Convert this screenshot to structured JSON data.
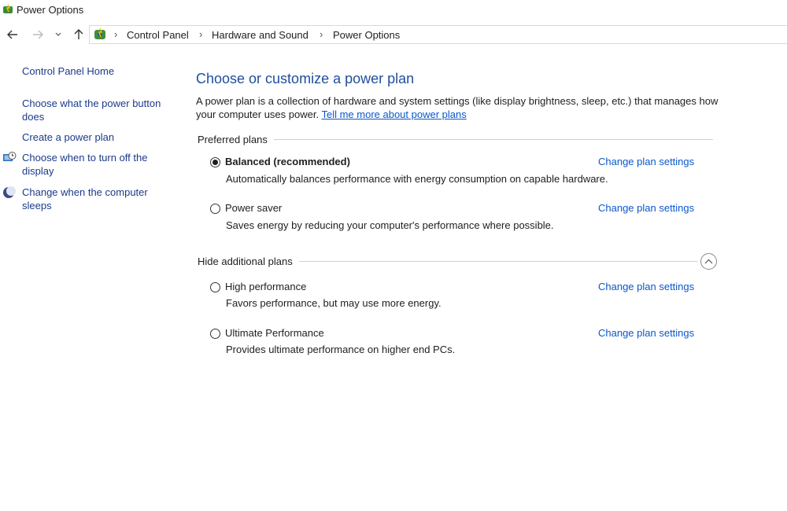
{
  "window": {
    "title": "Power Options"
  },
  "address_bar": {
    "breadcrumbs": [
      "Control Panel",
      "Hardware and Sound",
      "Power Options"
    ]
  },
  "sidebar": {
    "home": "Control Panel Home",
    "items": [
      {
        "label": "Choose what the power button does",
        "icon": null
      },
      {
        "label": "Create a power plan",
        "icon": null
      },
      {
        "label": "Choose when to turn off the display",
        "icon": "display-clock-icon"
      },
      {
        "label": "Change when the computer sleeps",
        "icon": "moon-icon"
      }
    ]
  },
  "main": {
    "title": "Choose or customize a power plan",
    "intro": "A power plan is a collection of hardware and system settings (like display brightness, sleep, etc.) that manages how your computer uses power.",
    "intro_link": "Tell me more about power plans",
    "preferred_label": "Preferred plans",
    "additional_label": "Hide additional plans",
    "change_link_label": "Change plan settings",
    "plans": [
      {
        "name": "Balanced (recommended)",
        "desc": "Automatically balances performance with energy consumption on capable hardware.",
        "selected": true
      },
      {
        "name": "Power saver",
        "desc": "Saves energy by reducing your computer's performance where possible.",
        "selected": false
      },
      {
        "name": "High performance",
        "desc": "Favors performance, but may use more energy.",
        "selected": false
      },
      {
        "name": "Ultimate Performance",
        "desc": "Provides ultimate performance on higher end PCs.",
        "selected": false
      }
    ]
  },
  "colors": {
    "link": "#0a58ca",
    "heading": "#1f4e9c",
    "sidebar_link": "#1b3a8c"
  }
}
